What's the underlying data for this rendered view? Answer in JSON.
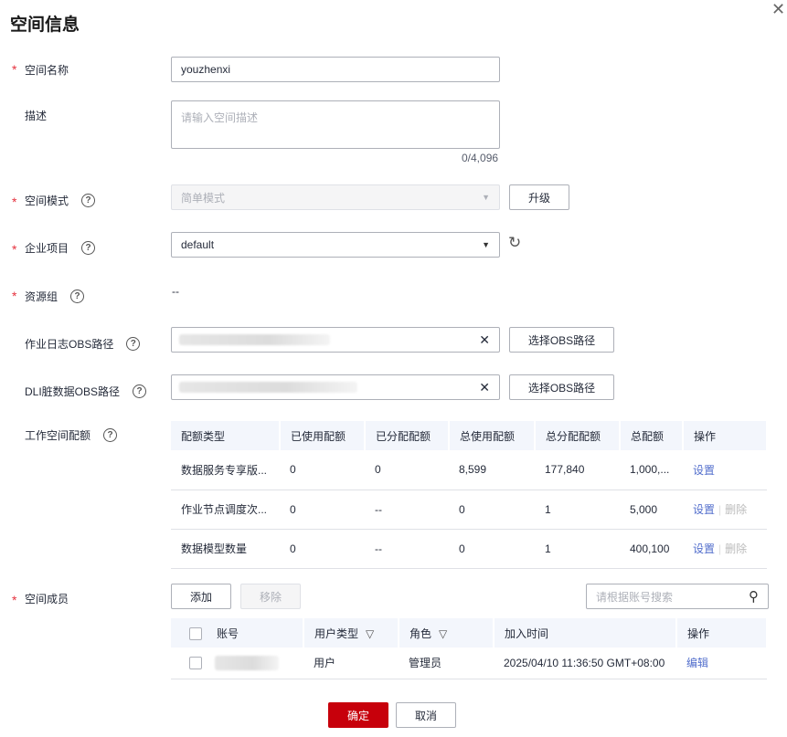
{
  "title": "空间信息",
  "fields": {
    "name": {
      "label": "空间名称",
      "value": "youzhenxi"
    },
    "desc": {
      "label": "描述",
      "placeholder": "请输入空间描述",
      "counter": "0/4,096"
    },
    "mode": {
      "label": "空间模式",
      "value": "简单模式",
      "upgrade": "升级"
    },
    "project": {
      "label": "企业项目",
      "value": "default"
    },
    "resource": {
      "label": "资源组",
      "value": "--"
    },
    "joblog": {
      "label": "作业日志OBS路径",
      "button": "选择OBS路径"
    },
    "dli": {
      "label": "DLI脏数据OBS路径",
      "button": "选择OBS路径"
    },
    "quota": {
      "label": "工作空间配额"
    },
    "members": {
      "label": "空间成员",
      "add": "添加",
      "remove": "移除",
      "search_placeholder": "请根据账号搜索"
    }
  },
  "quota_table": {
    "headers": [
      "配额类型",
      "已使用配额",
      "已分配配额",
      "总使用配额",
      "总分配配额",
      "总配额",
      "操作"
    ],
    "rows": [
      {
        "type": "数据服务专享版...",
        "used": "0",
        "allocated": "0",
        "total_used": "8,599",
        "total_alloc": "177,840",
        "total": "1,000,...",
        "set": "设置"
      },
      {
        "type": "作业节点调度次...",
        "used": "0",
        "allocated": "--",
        "total_used": "0",
        "total_alloc": "1",
        "total": "5,000",
        "set": "设置",
        "del": "删除"
      },
      {
        "type": "数据模型数量",
        "used": "0",
        "allocated": "--",
        "total_used": "0",
        "total_alloc": "1",
        "total": "400,100",
        "set": "设置",
        "del": "删除"
      }
    ]
  },
  "member_table": {
    "headers": [
      "账号",
      "用户类型",
      "角色",
      "加入时间",
      "操作"
    ],
    "rows": [
      {
        "type": "用户",
        "role": "管理员",
        "time": "2025/04/10 11:36:50 GMT+08:00",
        "edit": "编辑"
      }
    ]
  },
  "footer": {
    "ok": "确定",
    "cancel": "取消"
  }
}
